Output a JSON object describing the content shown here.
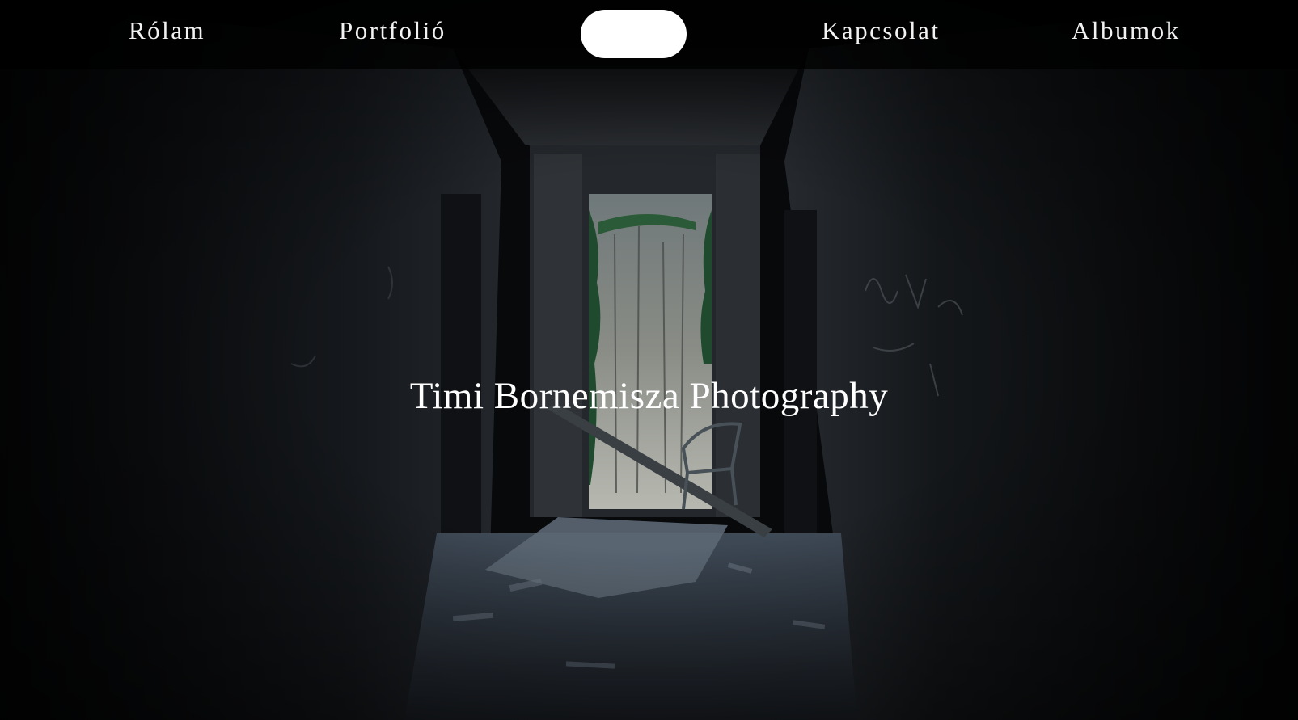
{
  "nav": {
    "items": [
      {
        "label": "Rólam"
      },
      {
        "label": "Portfolió"
      },
      {
        "label": "Kapcsolat"
      },
      {
        "label": "Albumok"
      }
    ]
  },
  "hero": {
    "title": "Timi Bornemisza Photography"
  },
  "colors": {
    "nav_background": "#000000",
    "text": "#ffffff",
    "logo_pill": "#ffffff"
  }
}
